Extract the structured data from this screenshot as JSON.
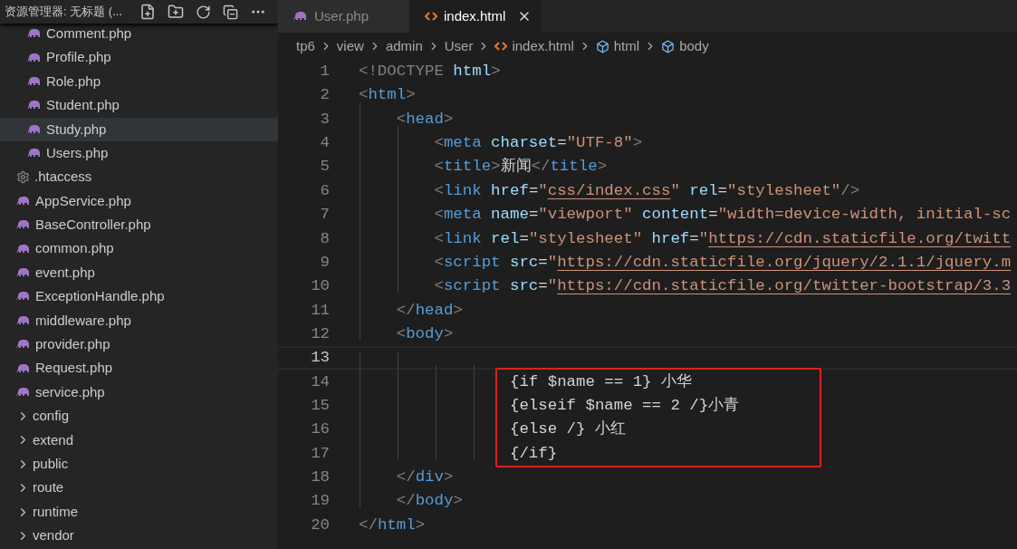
{
  "explorer": {
    "title": "资源管理器: 无标题 (...",
    "tree": [
      {
        "children": [
          {
            "name": "Comment.php",
            "kind": "php",
            "selected": false
          },
          {
            "name": "Profile.php",
            "kind": "php",
            "selected": false
          },
          {
            "name": "Role.php",
            "kind": "php",
            "selected": false
          },
          {
            "name": "Student.php",
            "kind": "php",
            "selected": false
          },
          {
            "name": "Study.php",
            "kind": "php",
            "selected": true
          },
          {
            "name": "Users.php",
            "kind": "php",
            "selected": false
          }
        ]
      },
      {
        "name": ".htaccess",
        "kind": "config",
        "selected": false
      },
      {
        "name": "AppService.php",
        "kind": "php",
        "selected": false
      },
      {
        "name": "BaseController.php",
        "kind": "php",
        "selected": false
      },
      {
        "name": "common.php",
        "kind": "php",
        "selected": false
      },
      {
        "name": "event.php",
        "kind": "php",
        "selected": false
      },
      {
        "name": "ExceptionHandle.php",
        "kind": "php",
        "selected": false
      },
      {
        "name": "middleware.php",
        "kind": "php",
        "selected": false
      },
      {
        "name": "provider.php",
        "kind": "php",
        "selected": false
      },
      {
        "name": "Request.php",
        "kind": "php",
        "selected": false
      },
      {
        "name": "service.php",
        "kind": "php",
        "selected": false
      },
      {
        "name": "config",
        "kind": "folder",
        "selected": false,
        "expanded": false
      },
      {
        "name": "extend",
        "kind": "folder",
        "selected": false,
        "expanded": false
      },
      {
        "name": "public",
        "kind": "folder",
        "selected": false,
        "expanded": false
      },
      {
        "name": "route",
        "kind": "folder",
        "selected": false,
        "expanded": false
      },
      {
        "name": "runtime",
        "kind": "folder",
        "selected": false,
        "expanded": false
      },
      {
        "name": "vendor",
        "kind": "folder",
        "selected": false,
        "expanded": false
      }
    ]
  },
  "tabs": [
    {
      "label": "User.php",
      "kind": "php",
      "selected": false
    },
    {
      "label": "index.html",
      "kind": "html",
      "selected": true
    }
  ],
  "breadcrumb": [
    {
      "label": "tp6",
      "kind": "folder"
    },
    {
      "label": "view",
      "kind": "folder"
    },
    {
      "label": "admin",
      "kind": "folder"
    },
    {
      "label": "User",
      "kind": "folder"
    },
    {
      "label": "index.html",
      "kind": "html"
    },
    {
      "label": "html",
      "kind": "element"
    },
    {
      "label": "body",
      "kind": "element"
    }
  ],
  "lines": [
    {
      "number": "1",
      "current": false,
      "boxed": false,
      "tokens": [
        {
          "kind": "bracket",
          "text": "<!DOCTYPE"
        },
        {
          "kind": "attr",
          "text": " html"
        },
        {
          "kind": "bracket",
          "text": ">"
        }
      ]
    },
    {
      "number": "2",
      "current": false,
      "boxed": false,
      "tokens": [
        {
          "kind": "bracket",
          "text": "<"
        },
        {
          "kind": "tag",
          "text": "html"
        },
        {
          "kind": "bracket",
          "text": ">"
        }
      ]
    },
    {
      "number": "3",
      "current": false,
      "boxed": false,
      "tokens": [
        {
          "kind": "bracket",
          "text": "    <"
        },
        {
          "kind": "tag",
          "text": "head"
        },
        {
          "kind": "bracket",
          "text": ">"
        }
      ]
    },
    {
      "number": "4",
      "current": false,
      "boxed": false,
      "tokens": [
        {
          "kind": "bracket",
          "text": "        <"
        },
        {
          "kind": "tag",
          "text": "meta"
        },
        {
          "kind": "attr",
          "text": " charset"
        },
        {
          "kind": "text",
          "text": "="
        },
        {
          "kind": "string",
          "text": "\"UTF-8\""
        },
        {
          "kind": "bracket",
          "text": ">"
        }
      ]
    },
    {
      "number": "5",
      "current": false,
      "boxed": false,
      "tokens": [
        {
          "kind": "bracket",
          "text": "        <"
        },
        {
          "kind": "tag",
          "text": "title"
        },
        {
          "kind": "bracket",
          "text": ">"
        },
        {
          "kind": "text",
          "text": "新闻"
        },
        {
          "kind": "bracket",
          "text": "</"
        },
        {
          "kind": "tag",
          "text": "title"
        },
        {
          "kind": "bracket",
          "text": ">"
        }
      ]
    },
    {
      "number": "6",
      "current": false,
      "boxed": false,
      "tokens": [
        {
          "kind": "bracket",
          "text": "        <"
        },
        {
          "kind": "tag",
          "text": "link"
        },
        {
          "kind": "attr",
          "text": " href"
        },
        {
          "kind": "text",
          "text": "="
        },
        {
          "kind": "string",
          "text": "\""
        },
        {
          "kind": "url",
          "text": "css/index.css"
        },
        {
          "kind": "string",
          "text": "\""
        },
        {
          "kind": "attr",
          "text": " rel"
        },
        {
          "kind": "text",
          "text": "="
        },
        {
          "kind": "string",
          "text": "\"stylesheet\""
        },
        {
          "kind": "bracket",
          "text": "/>"
        }
      ]
    },
    {
      "number": "7",
      "current": false,
      "boxed": false,
      "tokens": [
        {
          "kind": "bracket",
          "text": "        <"
        },
        {
          "kind": "tag",
          "text": "meta"
        },
        {
          "kind": "attr",
          "text": " name"
        },
        {
          "kind": "text",
          "text": "="
        },
        {
          "kind": "string",
          "text": "\"viewport\""
        },
        {
          "kind": "attr",
          "text": " content"
        },
        {
          "kind": "text",
          "text": "="
        },
        {
          "kind": "string",
          "text": "\"width=device-width, initial-sc"
        }
      ]
    },
    {
      "number": "8",
      "current": false,
      "boxed": false,
      "tokens": [
        {
          "kind": "bracket",
          "text": "        <"
        },
        {
          "kind": "tag",
          "text": "link"
        },
        {
          "kind": "attr",
          "text": " rel"
        },
        {
          "kind": "text",
          "text": "="
        },
        {
          "kind": "string",
          "text": "\"stylesheet\""
        },
        {
          "kind": "attr",
          "text": " href"
        },
        {
          "kind": "text",
          "text": "="
        },
        {
          "kind": "string",
          "text": "\""
        },
        {
          "kind": "url",
          "text": "https://cdn.staticfile.org/twitt"
        }
      ]
    },
    {
      "number": "9",
      "current": false,
      "boxed": false,
      "tokens": [
        {
          "kind": "bracket",
          "text": "        <"
        },
        {
          "kind": "tag",
          "text": "script"
        },
        {
          "kind": "attr",
          "text": " src"
        },
        {
          "kind": "text",
          "text": "="
        },
        {
          "kind": "string",
          "text": "\""
        },
        {
          "kind": "url",
          "text": "https://cdn.staticfile.org/jquery/2.1.1/jquery.m"
        }
      ]
    },
    {
      "number": "10",
      "current": false,
      "boxed": false,
      "tokens": [
        {
          "kind": "bracket",
          "text": "        <"
        },
        {
          "kind": "tag",
          "text": "script"
        },
        {
          "kind": "attr",
          "text": " src"
        },
        {
          "kind": "text",
          "text": "="
        },
        {
          "kind": "string",
          "text": "\""
        },
        {
          "kind": "url",
          "text": "https://cdn.staticfile.org/twitter-bootstrap/3.3"
        }
      ]
    },
    {
      "number": "11",
      "current": false,
      "boxed": false,
      "tokens": [
        {
          "kind": "bracket",
          "text": "    </"
        },
        {
          "kind": "tag",
          "text": "head"
        },
        {
          "kind": "bracket",
          "text": ">"
        }
      ]
    },
    {
      "number": "12",
      "current": false,
      "boxed": false,
      "tokens": [
        {
          "kind": "bracket",
          "text": "    <"
        },
        {
          "kind": "tag",
          "text": "body"
        },
        {
          "kind": "bracket",
          "text": ">"
        }
      ]
    },
    {
      "number": "13",
      "current": true,
      "boxed": false
    },
    {
      "number": "14",
      "current": false,
      "boxed": true,
      "tokens": [
        {
          "kind": "text",
          "text": "                {if $name == 1} 小华"
        }
      ]
    },
    {
      "number": "15",
      "current": false,
      "boxed": true,
      "tokens": [
        {
          "kind": "text",
          "text": "                {elseif $name == 2 /}小青"
        }
      ]
    },
    {
      "number": "16",
      "current": false,
      "boxed": true,
      "tokens": [
        {
          "kind": "text",
          "text": "                {else /} 小红"
        }
      ]
    },
    {
      "number": "17",
      "current": false,
      "boxed": true,
      "tokens": [
        {
          "kind": "text",
          "text": "                {/if}"
        }
      ]
    },
    {
      "number": "18",
      "current": false,
      "boxed": false,
      "tokens": [
        {
          "kind": "bracket",
          "text": "    </"
        },
        {
          "kind": "tag",
          "text": "div"
        },
        {
          "kind": "bracket",
          "text": ">"
        }
      ]
    },
    {
      "number": "19",
      "current": false,
      "boxed": false,
      "tokens": [
        {
          "kind": "bracket",
          "text": "    </"
        },
        {
          "kind": "tag",
          "text": "body"
        },
        {
          "kind": "bracket",
          "text": ">"
        }
      ]
    },
    {
      "number": "20",
      "current": false,
      "boxed": false,
      "tokens": [
        {
          "kind": "bracket",
          "text": "</"
        },
        {
          "kind": "tag",
          "text": "html"
        },
        {
          "kind": "bracket",
          "text": ">"
        }
      ]
    }
  ]
}
